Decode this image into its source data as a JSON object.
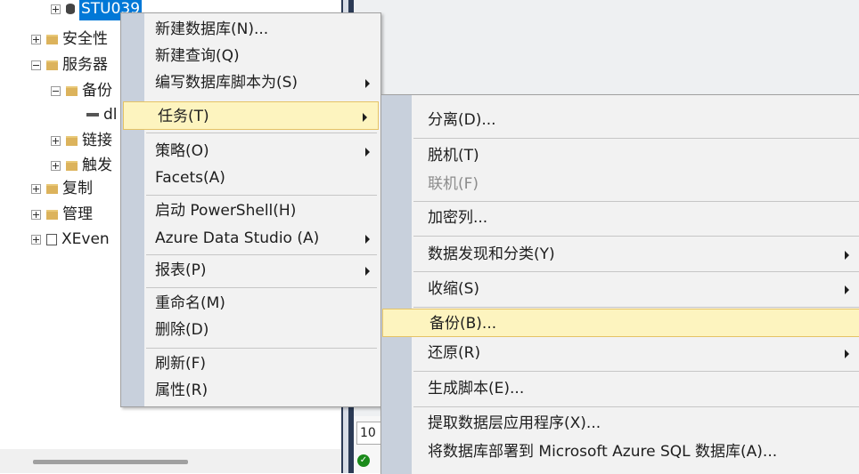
{
  "explorer": {
    "db_label": "STU039",
    "items": {
      "security": "安全性",
      "server_objects": "服务器",
      "backup_devices": "备份",
      "device_item": "dl",
      "linked": "链接",
      "triggers": "触发",
      "replication": "复制",
      "management": "管理",
      "xevent": "XEven"
    }
  },
  "context_menu": {
    "new_database": "新建数据库(N)...",
    "new_query": "新建查询(Q)",
    "script_as": "编写数据库脚本为(S)",
    "tasks": "任务(T)",
    "policies": "策略(O)",
    "facets": "Facets(A)",
    "powershell": "启动 PowerShell(H)",
    "azure_data_studio": "Azure Data Studio (A)",
    "reports": "报表(P)",
    "rename": "重命名(M)",
    "delete": "删除(D)",
    "refresh": "刷新(F)",
    "properties": "属性(R)"
  },
  "tasks_menu": {
    "detach": "分离(D)...",
    "take_offline": "脱机(T)",
    "bring_online": "联机(F)",
    "encrypt_columns": "加密列...",
    "data_discovery": "数据发现和分类(Y)",
    "shrink": "收缩(S)",
    "backup": "备份(B)...",
    "restore": "还原(R)",
    "generate_scripts": "生成脚本(E)...",
    "extract_data_tier": "提取数据层应用程序(X)...",
    "deploy_azure": "将数据库部署到 Microsoft Azure SQL 数据库(A)..."
  },
  "results": {
    "zoom": "10"
  },
  "colors": {
    "highlight": "#fdf4bf",
    "selection": "#0078d7",
    "menu_bg": "#f2f2f2",
    "gutter": "#c8d0dc"
  }
}
